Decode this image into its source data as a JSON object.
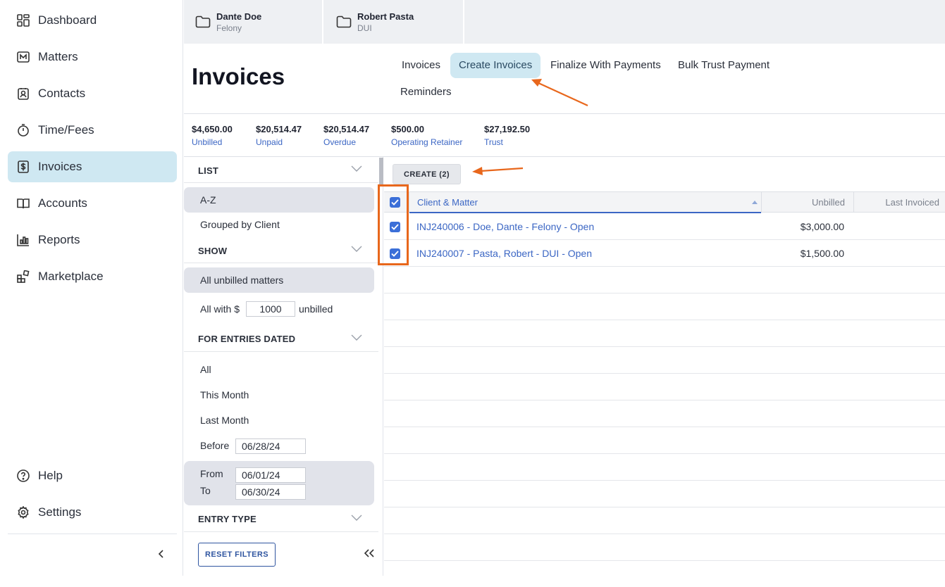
{
  "sidebar": {
    "items": [
      {
        "label": "Dashboard",
        "icon": "dashboard-icon"
      },
      {
        "label": "Matters",
        "icon": "matters-icon"
      },
      {
        "label": "Contacts",
        "icon": "contacts-icon"
      },
      {
        "label": "Time/Fees",
        "icon": "stopwatch-icon"
      },
      {
        "label": "Invoices",
        "icon": "dollar-doc-icon",
        "active": true
      },
      {
        "label": "Accounts",
        "icon": "book-icon"
      },
      {
        "label": "Reports",
        "icon": "bar-chart-icon"
      },
      {
        "label": "Marketplace",
        "icon": "blocks-icon"
      }
    ],
    "bottom": [
      {
        "label": "Help",
        "icon": "help-icon"
      },
      {
        "label": "Settings",
        "icon": "gear-icon"
      }
    ]
  },
  "matter_tabs": [
    {
      "name": "Dante Doe",
      "sub": "Felony"
    },
    {
      "name": "Robert Pasta",
      "sub": "DUI"
    }
  ],
  "header": {
    "title": "Invoices",
    "tabs": [
      "Invoices",
      "Create Invoices",
      "Finalize With Payments",
      "Bulk Trust Payment",
      "Reminders"
    ],
    "active_tab": "Create Invoices"
  },
  "stats": [
    {
      "value": "$4,650.00",
      "label": "Unbilled"
    },
    {
      "value": "$20,514.47",
      "label": "Unpaid"
    },
    {
      "value": "$20,514.47",
      "label": "Overdue"
    },
    {
      "value": "$500.00",
      "label": "Operating Retainer"
    },
    {
      "value": "$27,192.50",
      "label": "Trust"
    }
  ],
  "filters": {
    "list_heading": "LIST",
    "list_options": [
      "A-Z",
      "Grouped by Client"
    ],
    "show_heading": "SHOW",
    "show_all": "All unbilled matters",
    "show_with_prefix": "All with $",
    "show_with_amount": "1000",
    "show_with_suffix": "unbilled",
    "dated_heading": "FOR ENTRIES DATED",
    "dated_options": [
      "All",
      "This Month",
      "Last Month"
    ],
    "before_label": "Before",
    "before_value": "06/28/24",
    "from_label": "From",
    "from_value": "06/01/24",
    "to_label": "To",
    "to_value": "06/30/24",
    "entry_type_heading": "ENTRY TYPE",
    "reset_label": "RESET FILTERS"
  },
  "grid": {
    "create_label": "CREATE (2)",
    "columns": [
      "Client & Matter",
      "Unbilled",
      "Last Invoiced"
    ],
    "rows": [
      {
        "matter": "INJ240006 - Doe, Dante - Felony - Open",
        "unbilled": "$3,000.00",
        "checked": true
      },
      {
        "matter": "INJ240007 - Pasta, Robert - DUI - Open",
        "unbilled": "$1,500.00",
        "checked": true
      }
    ]
  },
  "colors": {
    "accent": "#cfe8f2",
    "link": "#3b66c4",
    "checkbox": "#3b6fd8",
    "annotation": "#e8671c"
  }
}
